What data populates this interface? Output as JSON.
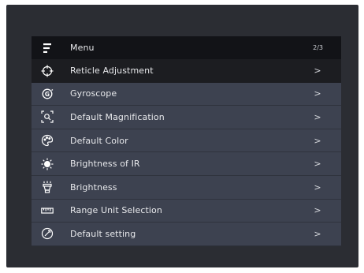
{
  "menu": {
    "title": "Menu",
    "page_indicator": "2/3",
    "items": [
      {
        "label": "Reticle Adjustment",
        "chevron": ">",
        "icon": "crosshair-icon"
      },
      {
        "label": "Gyroscope",
        "chevron": ">",
        "icon": "gyroscope-icon"
      },
      {
        "label": "Default Magnification",
        "chevron": ">",
        "icon": "magnification-icon"
      },
      {
        "label": "Default Color",
        "chevron": ">",
        "icon": "palette-icon"
      },
      {
        "label": "Brightness of IR",
        "chevron": ">",
        "icon": "ir-brightness-icon"
      },
      {
        "label": "Brightness",
        "chevron": ">",
        "icon": "brightness-icon"
      },
      {
        "label": "Range Unit Selection",
        "chevron": ">",
        "icon": "ruler-icon"
      },
      {
        "label": "Default setting",
        "chevron": ">",
        "icon": "reset-icon"
      }
    ]
  },
  "colors": {
    "background": "#2b2d33",
    "header": "#121317",
    "selected_row": "#1c1d21",
    "row": "#3d4250",
    "text": "#e8e9ec"
  }
}
